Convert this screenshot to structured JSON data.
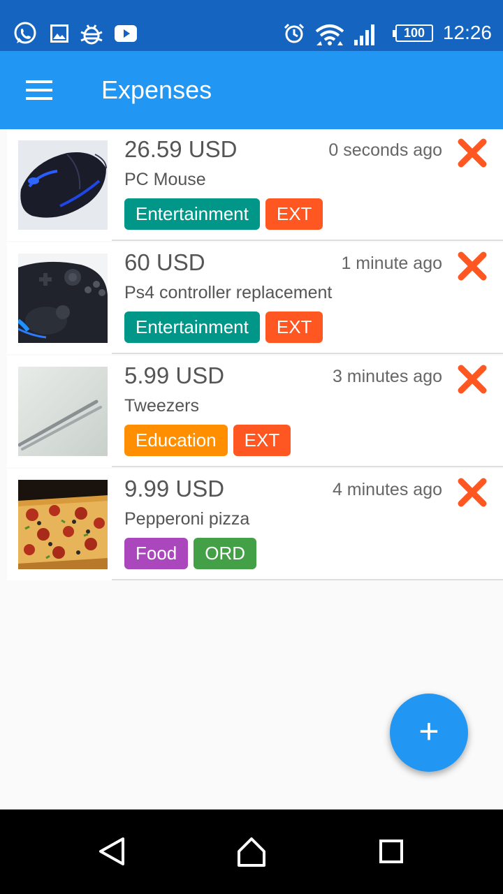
{
  "status_bar": {
    "time": "12:26",
    "battery": "100",
    "icons": [
      "whatsapp-icon",
      "image-icon",
      "bug-icon",
      "youtube-icon",
      "alarm-icon",
      "wifi-icon",
      "signal-icon"
    ]
  },
  "app_bar": {
    "title": "Expenses",
    "menu_icon": "hamburger-menu-icon"
  },
  "expenses": [
    {
      "amount": "26.59 USD",
      "time": "0 seconds ago",
      "name": "PC Mouse",
      "tags": [
        {
          "label": "Entertainment",
          "color": "#009688"
        },
        {
          "label": "EXT",
          "color": "#ff5722"
        }
      ]
    },
    {
      "amount": "60 USD",
      "time": "1 minute ago",
      "name": "Ps4 controller replacement",
      "tags": [
        {
          "label": "Entertainment",
          "color": "#009688"
        },
        {
          "label": "EXT",
          "color": "#ff5722"
        }
      ]
    },
    {
      "amount": "5.99 USD",
      "time": "3 minutes ago",
      "name": "Tweezers",
      "tags": [
        {
          "label": "Education",
          "color": "#ff8f00"
        },
        {
          "label": "EXT",
          "color": "#ff5722"
        }
      ]
    },
    {
      "amount": "9.99 USD",
      "time": "4 minutes ago",
      "name": "Pepperoni pizza",
      "tags": [
        {
          "label": "Food",
          "color": "#ab47bc"
        },
        {
          "label": "ORD",
          "color": "#43a047"
        }
      ]
    }
  ],
  "fab": {
    "label": "+"
  },
  "colors": {
    "status_bar": "#1565c0",
    "app_bar": "#2196f3",
    "delete": "#ff5722",
    "fab": "#2196f3"
  },
  "nav_bar": {
    "icons": [
      "back-icon",
      "home-icon",
      "recents-icon"
    ]
  }
}
